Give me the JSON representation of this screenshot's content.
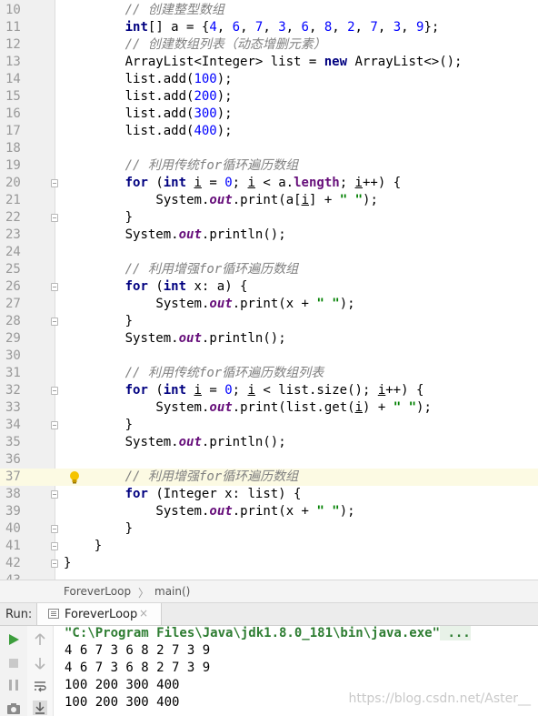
{
  "editor": {
    "lines": [
      {
        "n": "10",
        "indent": 2,
        "fold": false,
        "tokens": [
          {
            "t": "// 创建整型数组",
            "c": "cmt"
          }
        ]
      },
      {
        "n": "11",
        "indent": 2,
        "fold": false,
        "tokens": [
          {
            "t": "int",
            "c": "kw"
          },
          {
            "t": "[] a = {"
          },
          {
            "t": "4",
            "c": "num"
          },
          {
            "t": ", "
          },
          {
            "t": "6",
            "c": "num"
          },
          {
            "t": ", "
          },
          {
            "t": "7",
            "c": "num"
          },
          {
            "t": ", "
          },
          {
            "t": "3",
            "c": "num"
          },
          {
            "t": ", "
          },
          {
            "t": "6",
            "c": "num"
          },
          {
            "t": ", "
          },
          {
            "t": "8",
            "c": "num"
          },
          {
            "t": ", "
          },
          {
            "t": "2",
            "c": "num"
          },
          {
            "t": ", "
          },
          {
            "t": "7",
            "c": "num"
          },
          {
            "t": ", "
          },
          {
            "t": "3",
            "c": "num"
          },
          {
            "t": ", "
          },
          {
            "t": "9",
            "c": "num"
          },
          {
            "t": "};"
          }
        ]
      },
      {
        "n": "12",
        "indent": 2,
        "fold": false,
        "tokens": [
          {
            "t": "// 创建数组列表（动态增删元素）",
            "c": "cmt"
          }
        ]
      },
      {
        "n": "13",
        "indent": 2,
        "fold": false,
        "tokens": [
          {
            "t": "ArrayList<Integer> list = "
          },
          {
            "t": "new",
            "c": "kw"
          },
          {
            "t": " ArrayList<>();"
          }
        ]
      },
      {
        "n": "14",
        "indent": 2,
        "fold": false,
        "tokens": [
          {
            "t": "list.add("
          },
          {
            "t": "100",
            "c": "num"
          },
          {
            "t": ");"
          }
        ]
      },
      {
        "n": "15",
        "indent": 2,
        "fold": false,
        "tokens": [
          {
            "t": "list.add("
          },
          {
            "t": "200",
            "c": "num"
          },
          {
            "t": ");"
          }
        ]
      },
      {
        "n": "16",
        "indent": 2,
        "fold": false,
        "tokens": [
          {
            "t": "list.add("
          },
          {
            "t": "300",
            "c": "num"
          },
          {
            "t": ");"
          }
        ]
      },
      {
        "n": "17",
        "indent": 2,
        "fold": false,
        "tokens": [
          {
            "t": "list.add("
          },
          {
            "t": "400",
            "c": "num"
          },
          {
            "t": ");"
          }
        ]
      },
      {
        "n": "18",
        "indent": 0,
        "fold": false,
        "tokens": []
      },
      {
        "n": "19",
        "indent": 2,
        "fold": false,
        "tokens": [
          {
            "t": "// 利用传统",
            "c": "cmt"
          },
          {
            "t": "for",
            "c": "cmt"
          },
          {
            "t": "循环遍历数组",
            "c": "cmt"
          }
        ]
      },
      {
        "n": "20",
        "indent": 2,
        "fold": true,
        "tokens": [
          {
            "t": "for",
            "c": "kw"
          },
          {
            "t": " ("
          },
          {
            "t": "int",
            "c": "kw"
          },
          {
            "t": " "
          },
          {
            "t": "i",
            "c": "ul"
          },
          {
            "t": " = "
          },
          {
            "t": "0",
            "c": "num"
          },
          {
            "t": "; "
          },
          {
            "t": "i",
            "c": "ul"
          },
          {
            "t": " < a."
          },
          {
            "t": "length",
            "c": "fld2"
          },
          {
            "t": "; "
          },
          {
            "t": "i",
            "c": "ul"
          },
          {
            "t": "++) {"
          }
        ]
      },
      {
        "n": "21",
        "indent": 3,
        "fold": false,
        "tokens": [
          {
            "t": "System."
          },
          {
            "t": "out",
            "c": "fld"
          },
          {
            "t": ".print(a["
          },
          {
            "t": "i",
            "c": "ul"
          },
          {
            "t": "] + "
          },
          {
            "t": "\" \"",
            "c": "str"
          },
          {
            "t": ");"
          }
        ]
      },
      {
        "n": "22",
        "indent": 2,
        "fold": true,
        "tokens": [
          {
            "t": "}"
          }
        ]
      },
      {
        "n": "23",
        "indent": 2,
        "fold": false,
        "tokens": [
          {
            "t": "System."
          },
          {
            "t": "out",
            "c": "fld"
          },
          {
            "t": ".println();"
          }
        ]
      },
      {
        "n": "24",
        "indent": 0,
        "fold": false,
        "tokens": []
      },
      {
        "n": "25",
        "indent": 2,
        "fold": false,
        "tokens": [
          {
            "t": "// 利用增强",
            "c": "cmt"
          },
          {
            "t": "for",
            "c": "cmt"
          },
          {
            "t": "循环遍历数组",
            "c": "cmt"
          }
        ]
      },
      {
        "n": "26",
        "indent": 2,
        "fold": true,
        "tokens": [
          {
            "t": "for",
            "c": "kw"
          },
          {
            "t": " ("
          },
          {
            "t": "int",
            "c": "kw"
          },
          {
            "t": " x: a) {"
          }
        ]
      },
      {
        "n": "27",
        "indent": 3,
        "fold": false,
        "tokens": [
          {
            "t": "System."
          },
          {
            "t": "out",
            "c": "fld"
          },
          {
            "t": ".print(x + "
          },
          {
            "t": "\" \"",
            "c": "str"
          },
          {
            "t": ");"
          }
        ]
      },
      {
        "n": "28",
        "indent": 2,
        "fold": true,
        "tokens": [
          {
            "t": "}"
          }
        ]
      },
      {
        "n": "29",
        "indent": 2,
        "fold": false,
        "tokens": [
          {
            "t": "System."
          },
          {
            "t": "out",
            "c": "fld"
          },
          {
            "t": ".println();"
          }
        ]
      },
      {
        "n": "30",
        "indent": 0,
        "fold": false,
        "tokens": []
      },
      {
        "n": "31",
        "indent": 2,
        "fold": false,
        "tokens": [
          {
            "t": "// 利用传统",
            "c": "cmt"
          },
          {
            "t": "for",
            "c": "cmt"
          },
          {
            "t": "循环遍历数组列表",
            "c": "cmt"
          }
        ]
      },
      {
        "n": "32",
        "indent": 2,
        "fold": true,
        "tokens": [
          {
            "t": "for",
            "c": "kw"
          },
          {
            "t": " ("
          },
          {
            "t": "int",
            "c": "kw"
          },
          {
            "t": " "
          },
          {
            "t": "i",
            "c": "ul"
          },
          {
            "t": " = "
          },
          {
            "t": "0",
            "c": "num"
          },
          {
            "t": "; "
          },
          {
            "t": "i",
            "c": "ul"
          },
          {
            "t": " < list.size(); "
          },
          {
            "t": "i",
            "c": "ul"
          },
          {
            "t": "++) {"
          }
        ]
      },
      {
        "n": "33",
        "indent": 3,
        "fold": false,
        "tokens": [
          {
            "t": "System."
          },
          {
            "t": "out",
            "c": "fld"
          },
          {
            "t": ".print(list.get("
          },
          {
            "t": "i",
            "c": "ul"
          },
          {
            "t": ") + "
          },
          {
            "t": "\" \"",
            "c": "str"
          },
          {
            "t": ");"
          }
        ]
      },
      {
        "n": "34",
        "indent": 2,
        "fold": true,
        "tokens": [
          {
            "t": "}"
          }
        ]
      },
      {
        "n": "35",
        "indent": 2,
        "fold": false,
        "tokens": [
          {
            "t": "System."
          },
          {
            "t": "out",
            "c": "fld"
          },
          {
            "t": ".println();"
          }
        ]
      },
      {
        "n": "36",
        "indent": 0,
        "fold": false,
        "tokens": []
      },
      {
        "n": "37",
        "indent": 2,
        "fold": false,
        "current": true,
        "bulb": true,
        "tokens": [
          {
            "t": "// 利用增强",
            "c": "cmt"
          },
          {
            "t": "for",
            "c": "cmt"
          },
          {
            "t": "循环遍历数组",
            "c": "cmt"
          }
        ]
      },
      {
        "n": "38",
        "indent": 2,
        "fold": true,
        "tokens": [
          {
            "t": "for",
            "c": "kw"
          },
          {
            "t": " (Integer x: list) {"
          }
        ]
      },
      {
        "n": "39",
        "indent": 3,
        "fold": false,
        "tokens": [
          {
            "t": "System."
          },
          {
            "t": "out",
            "c": "fld"
          },
          {
            "t": ".print(x + "
          },
          {
            "t": "\" \"",
            "c": "str"
          },
          {
            "t": ");"
          }
        ]
      },
      {
        "n": "40",
        "indent": 2,
        "fold": true,
        "tokens": [
          {
            "t": "}"
          }
        ]
      },
      {
        "n": "41",
        "indent": 1,
        "fold": true,
        "tokens": [
          {
            "t": "}"
          }
        ]
      },
      {
        "n": "42",
        "indent": 0,
        "fold": true,
        "tokens": [
          {
            "t": "}"
          }
        ]
      },
      {
        "n": "43",
        "indent": 0,
        "fold": false,
        "tokens": []
      }
    ]
  },
  "breadcrumb": {
    "class_name": "ForeverLoop",
    "separator": "〉",
    "method": "main()"
  },
  "run_panel": {
    "label": "Run:",
    "tab_label": "ForeverLoop",
    "tab_close": "×"
  },
  "console": {
    "command": "\"C:\\Program Files\\Java\\jdk1.8.0_181\\bin\\java.exe\"",
    "command_more": " ...",
    "output": [
      "4 6 7 3 6 8 2 7 3 9",
      "4 6 7 3 6 8 2 7 3 9",
      "100 200 300 400",
      "100 200 300 400"
    ],
    "watermark": "https://blog.csdn.net/Aster__"
  },
  "colors": {
    "keyword": "#000080",
    "number": "#0000ff",
    "string": "#008000",
    "comment": "#808080",
    "field": "#660e7a",
    "current_line": "#fcfae3",
    "run_green": "#3d9e3d"
  },
  "icons": [
    "intention-bulb-icon",
    "fold-marker-icon",
    "run-icon",
    "stop-icon",
    "pause-icon",
    "camera-icon",
    "scroll-up-icon",
    "scroll-down-icon",
    "soft-wrap-icon",
    "scroll-to-end-icon",
    "console-tab-icon",
    "close-icon"
  ]
}
